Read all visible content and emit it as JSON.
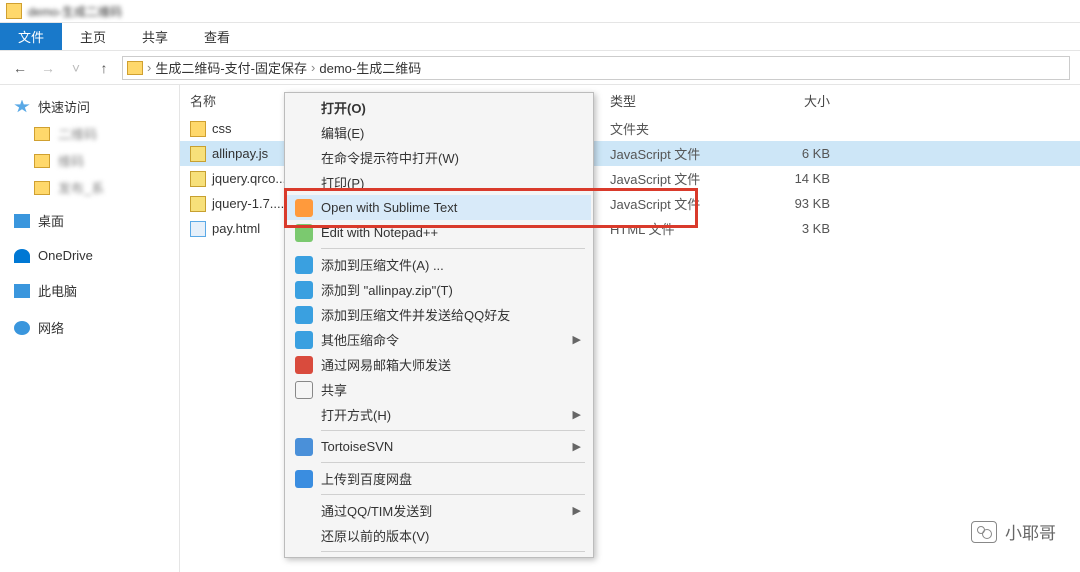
{
  "titlebar": {
    "title": "demo-生成二维码"
  },
  "ribbon": {
    "tabs": [
      {
        "label": "文件",
        "active": true
      },
      {
        "label": "主页",
        "active": false
      },
      {
        "label": "共享",
        "active": false
      },
      {
        "label": "查看",
        "active": false
      }
    ]
  },
  "breadcrumb": {
    "sep": "›",
    "parts": [
      "生成二维码-支付-固定保存",
      "demo-生成二维码"
    ]
  },
  "sidebar": {
    "quick": "快速访问",
    "items_blur": [
      "二维码",
      "维码",
      "发布_系"
    ],
    "desktop": "桌面",
    "onedrive": "OneDrive",
    "thispc": "此电脑",
    "network": "网络"
  },
  "columns": {
    "name": "名称",
    "type": "类型",
    "size": "大小"
  },
  "files": [
    {
      "name": "css",
      "type": "文件夹",
      "size": "",
      "icon": "folder",
      "selected": false
    },
    {
      "name": "allinpay.js",
      "type": "JavaScript 文件",
      "size": "6 KB",
      "icon": "js",
      "selected": true
    },
    {
      "name": "jquery.qrco...",
      "type": "JavaScript 文件",
      "size": "14 KB",
      "icon": "js",
      "selected": false
    },
    {
      "name": "jquery-1.7....",
      "type": "JavaScript 文件",
      "size": "93 KB",
      "icon": "js",
      "selected": false
    },
    {
      "name": "pay.html",
      "type": "HTML 文件",
      "size": "3 KB",
      "icon": "html",
      "selected": false
    }
  ],
  "context_menu": {
    "open": "打开(O)",
    "edit": "编辑(E)",
    "cmd_open": "在命令提示符中打开(W)",
    "print": "打印(P)",
    "sublime": "Open with Sublime Text",
    "notepadpp": "Edit with Notepad++",
    "add_archive": "添加到压缩文件(A) ...",
    "add_zip": "添加到 \"allinpay.zip\"(T)",
    "add_send_qq": "添加到压缩文件并发送给QQ好友",
    "other_compress": "其他压缩命令",
    "netease_send": "通过网易邮箱大师发送",
    "share": "共享",
    "open_with": "打开方式(H)",
    "tortoise": "TortoiseSVN",
    "upload_baidu": "上传到百度网盘",
    "send_qq_tim": "通过QQ/TIM发送到",
    "prev_version": "还原以前的版本(V)"
  },
  "watermark": "小耶哥"
}
